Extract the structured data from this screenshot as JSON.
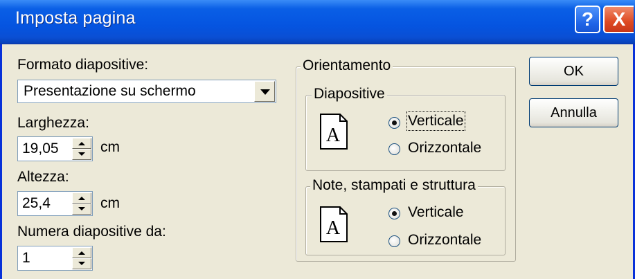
{
  "dialog": {
    "title": "Imposta pagina"
  },
  "titlebar_buttons": {
    "help": "?",
    "close": "X"
  },
  "slide_format": {
    "label": "Formato diapositive:",
    "selected": "Presentazione su schermo"
  },
  "width": {
    "label": "Larghezza:",
    "value": "19,05",
    "unit": "cm"
  },
  "height": {
    "label": "Altezza:",
    "value": "25,4",
    "unit": "cm"
  },
  "numbering": {
    "label": "Numera diapositive da:",
    "value": "1"
  },
  "orientation": {
    "legend": "Orientamento",
    "slides": {
      "legend": "Diapositive",
      "options": [
        "Verticale",
        "Orizzontale"
      ],
      "selected": "Verticale"
    },
    "notes": {
      "legend": "Note, stampati e struttura",
      "options": [
        "Verticale",
        "Orizzontale"
      ],
      "selected": "Verticale"
    },
    "icon_letter": "A"
  },
  "buttons": {
    "ok": "OK",
    "cancel": "Annulla"
  }
}
